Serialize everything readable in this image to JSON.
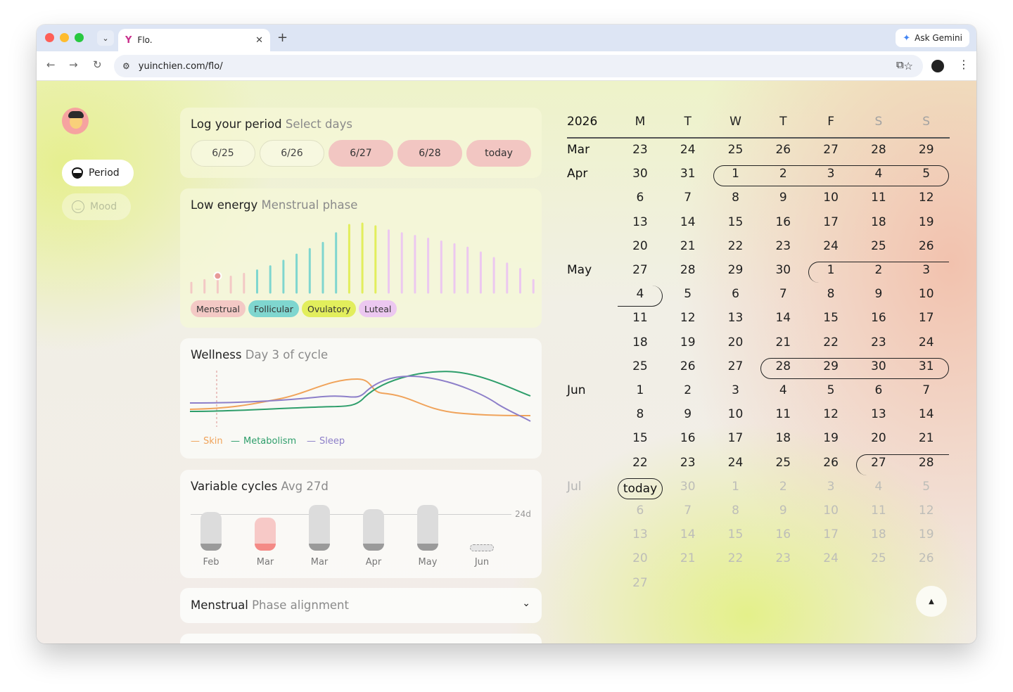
{
  "browser": {
    "tab_title": "Flo.",
    "tab_icon": "flo-logo-icon",
    "gemini_label": "Ask Gemini",
    "url": "yuinchien.com/flo/"
  },
  "sidebar": {
    "period_label": "Period",
    "mood_label": "Mood"
  },
  "log_period": {
    "title": "Log your period",
    "subtitle": "Select days",
    "days": [
      {
        "label": "6/25",
        "selected": false
      },
      {
        "label": "6/26",
        "selected": false
      },
      {
        "label": "6/27",
        "selected": true
      },
      {
        "label": "6/28",
        "selected": true
      },
      {
        "label": "today",
        "selected": true
      }
    ]
  },
  "energy": {
    "title": "Low energy",
    "subtitle": "Menstrual phase",
    "bar_levels": [
      0.14,
      0.18,
      0.2,
      0.23,
      0.27,
      0.32,
      0.38,
      0.46,
      0.55,
      0.63,
      0.72,
      0.86,
      0.98,
      1.0,
      0.96,
      0.9,
      0.86,
      0.82,
      0.78,
      0.74,
      0.7,
      0.65,
      0.58,
      0.5,
      0.42,
      0.34,
      0.18
    ],
    "bar_phases": [
      "menstrual",
      "menstrual",
      "menstrual",
      "menstrual",
      "menstrual",
      "follicular",
      "follicular",
      "follicular",
      "follicular",
      "follicular",
      "follicular",
      "follicular",
      "ovulatory",
      "ovulatory",
      "ovulatory",
      "luteal",
      "luteal",
      "luteal",
      "luteal",
      "luteal",
      "luteal",
      "luteal",
      "luteal",
      "luteal",
      "luteal",
      "luteal",
      "luteal"
    ],
    "current_day_index": 2,
    "phases": [
      {
        "label": "Menstrual",
        "color": "#f3c9c5"
      },
      {
        "label": "Follicular",
        "color": "#7fd6cf"
      },
      {
        "label": "Ovulatory",
        "color": "#e2ee5c"
      },
      {
        "label": "Luteal",
        "color": "#ecc8f0"
      }
    ]
  },
  "wellness": {
    "title": "Wellness",
    "subtitle": "Day 3 of cycle",
    "legend": [
      {
        "label": "Skin",
        "color": "#f0a35a"
      },
      {
        "label": "Metabolism",
        "color": "#2e9e6b"
      },
      {
        "label": "Sleep",
        "color": "#8d7fc9"
      }
    ]
  },
  "cycles": {
    "title": "Variable cycles",
    "subtitle": "Avg 27d",
    "reference_label": "24d",
    "months": [
      "Feb",
      "Mar",
      "Mar",
      "Apr",
      "May",
      "Jun"
    ]
  },
  "alignment": {
    "title": "Menstrual",
    "subtitle": "Phase alignment"
  },
  "calendar": {
    "year": "2026",
    "weekdays": [
      "M",
      "T",
      "W",
      "T",
      "F",
      "S",
      "S"
    ],
    "today_label": "today",
    "rows": [
      {
        "month": "Mar",
        "days": [
          "23",
          "24",
          "25",
          "26",
          "27",
          "28",
          "29"
        ]
      },
      {
        "month": "Apr",
        "days": [
          "30",
          "31",
          "1",
          "2",
          "3",
          "4",
          "5"
        ]
      },
      {
        "month": "",
        "days": [
          "6",
          "7",
          "8",
          "9",
          "10",
          "11",
          "12"
        ]
      },
      {
        "month": "",
        "days": [
          "13",
          "14",
          "15",
          "16",
          "17",
          "18",
          "19"
        ]
      },
      {
        "month": "",
        "days": [
          "20",
          "21",
          "22",
          "23",
          "24",
          "25",
          "26"
        ]
      },
      {
        "month": "May",
        "days": [
          "27",
          "28",
          "29",
          "30",
          "1",
          "2",
          "3"
        ]
      },
      {
        "month": "",
        "days": [
          "4",
          "5",
          "6",
          "7",
          "8",
          "9",
          "10"
        ]
      },
      {
        "month": "",
        "days": [
          "11",
          "12",
          "13",
          "14",
          "15",
          "16",
          "17"
        ]
      },
      {
        "month": "",
        "days": [
          "18",
          "19",
          "20",
          "21",
          "22",
          "23",
          "24"
        ]
      },
      {
        "month": "",
        "days": [
          "25",
          "26",
          "27",
          "28",
          "29",
          "30",
          "31"
        ]
      },
      {
        "month": "Jun",
        "days": [
          "1",
          "2",
          "3",
          "4",
          "5",
          "6",
          "7"
        ]
      },
      {
        "month": "",
        "days": [
          "8",
          "9",
          "10",
          "11",
          "12",
          "13",
          "14"
        ]
      },
      {
        "month": "",
        "days": [
          "15",
          "16",
          "17",
          "18",
          "19",
          "20",
          "21"
        ]
      },
      {
        "month": "",
        "days": [
          "22",
          "23",
          "24",
          "25",
          "26",
          "27",
          "28"
        ]
      },
      {
        "month": "Jul",
        "days": [
          "today",
          "30",
          "1",
          "2",
          "3",
          "4",
          "5"
        ]
      },
      {
        "month": "",
        "days": [
          "6",
          "7",
          "8",
          "9",
          "10",
          "11",
          "12"
        ]
      },
      {
        "month": "",
        "days": [
          "13",
          "14",
          "15",
          "16",
          "17",
          "18",
          "19"
        ]
      },
      {
        "month": "",
        "days": [
          "20",
          "21",
          "22",
          "23",
          "24",
          "25",
          "26"
        ]
      },
      {
        "month": "",
        "days": [
          "27"
        ]
      }
    ]
  }
}
